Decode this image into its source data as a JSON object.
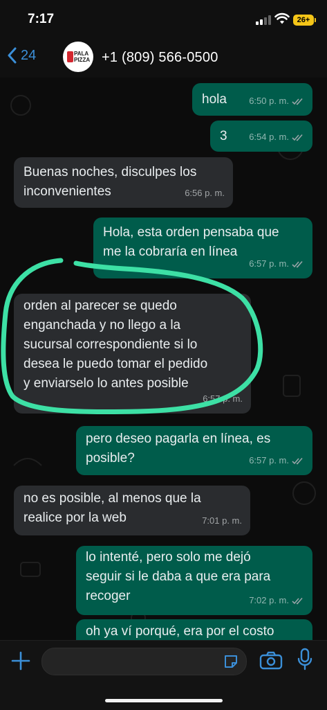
{
  "status_bar": {
    "time": "7:17",
    "battery": "26+"
  },
  "header": {
    "back_count": "24",
    "contact": "+1 (809) 566-0500",
    "avatar_logo_text": "PALA PIZZA"
  },
  "messages": [
    {
      "dir": "out",
      "text": "hola",
      "time": "6:50 p. m.",
      "read": true
    },
    {
      "dir": "out",
      "text": "3",
      "time": "6:54 p. m.",
      "read": true
    },
    {
      "dir": "in",
      "text": "Buenas noches, disculpes los\ninconvenientes",
      "time": "6:56 p. m."
    },
    {
      "dir": "out",
      "text": "Hola, esta orden pensaba que\nme la cobraría en línea",
      "time": "6:57 p. m.",
      "read": true
    },
    {
      "dir": "in",
      "text": "orden al parecer se quedo\nenganchada y no llego a la\nsucursal correspondiente si lo\ndesea le puedo tomar el pedido\ny enviarselo lo antes posible",
      "time": "6:57 p. m."
    },
    {
      "dir": "out",
      "text": "pero deseo pagarla en línea, es\nposible?",
      "time": "6:57 p. m.",
      "read": true
    },
    {
      "dir": "in",
      "text": "no es  posible, al menos que la\nrealice por la web",
      "time": "7:01 p. m."
    },
    {
      "dir": "out",
      "text": "lo intenté, pero solo me dejó\nseguir si le daba a que era para\nrecoger",
      "time": "7:02 p. m.",
      "read": true
    },
    {
      "dir": "out",
      "text": "oh ya ví porqué, era por el costo",
      "time": "",
      "read": false
    }
  ],
  "input": {
    "placeholder": ""
  },
  "colors": {
    "outgoing": "#005c4b",
    "incoming": "#2a2c2f",
    "accent": "#3b8fd8",
    "annotation": "#3de0a5"
  },
  "icons": [
    "back-chevron-icon",
    "plus-icon",
    "sticker-icon",
    "camera-icon",
    "mic-icon",
    "double-check-icon",
    "wifi-icon",
    "signal-icon",
    "battery-icon"
  ]
}
